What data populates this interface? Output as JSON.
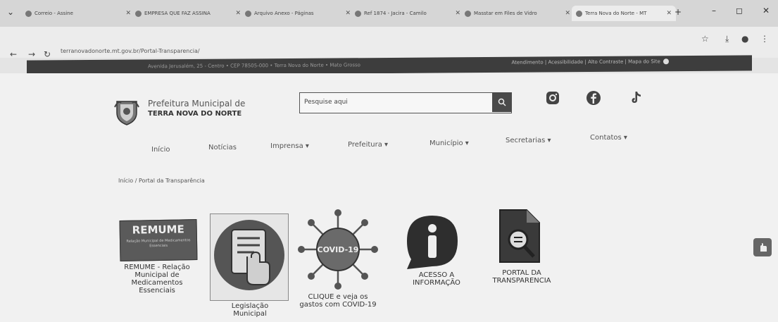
{
  "browser": {
    "tabs": [
      {
        "label": "Correio - Assine"
      },
      {
        "label": "EMPRESA QUE FAZ ASSINA"
      },
      {
        "label": "Arquivo Anexo - Páginas"
      },
      {
        "label": "Ref 1874 - Jacira - Camilo"
      },
      {
        "label": "Masstar em Files de Vidro"
      },
      {
        "label": "Terra Nova do Norte - MT"
      }
    ],
    "url": "terranovadonorte.mt.gov.br/Portal-Transparencia/"
  },
  "site_bar": {
    "left_text": "Avenida Jerusalém, 25 - Centro • CEP 78505-000 • Terra Nova do Norte • Mato Grosso",
    "right_links": "Atendimento | Acessibilidade | Alto Contraste | Mapa do Site"
  },
  "header": {
    "logo_line1": "Prefeitura Municipal de",
    "logo_line2": "TERRA NOVA DO NORTE",
    "search_placeholder": "Pesquise aqui"
  },
  "menu": [
    {
      "label": "Início"
    },
    {
      "label": "Notícias"
    },
    {
      "label": "Imprensa ▾"
    },
    {
      "label": "Prefeitura ▾"
    },
    {
      "label": "Município ▾"
    },
    {
      "label": "Secretarias ▾"
    },
    {
      "label": "Contatos ▾"
    }
  ],
  "breadcrumb": "Início  /  Portal da Transparência",
  "cards": [
    {
      "label": "REMUME - Relação Municipal de Medicamentos Essenciais",
      "banner_title": "REMUME",
      "banner_sub": "Relação Municipal de Medicamentos Essenciais"
    },
    {
      "label": "Legislação Municipal"
    },
    {
      "label": "CLIQUE e veja os gastos com COVID-19",
      "icon_text": "COVID-19"
    },
    {
      "label": "ACESSO A INFORMAÇÃO"
    },
    {
      "label": "PORTAL DA TRANSPARENCIA"
    }
  ]
}
